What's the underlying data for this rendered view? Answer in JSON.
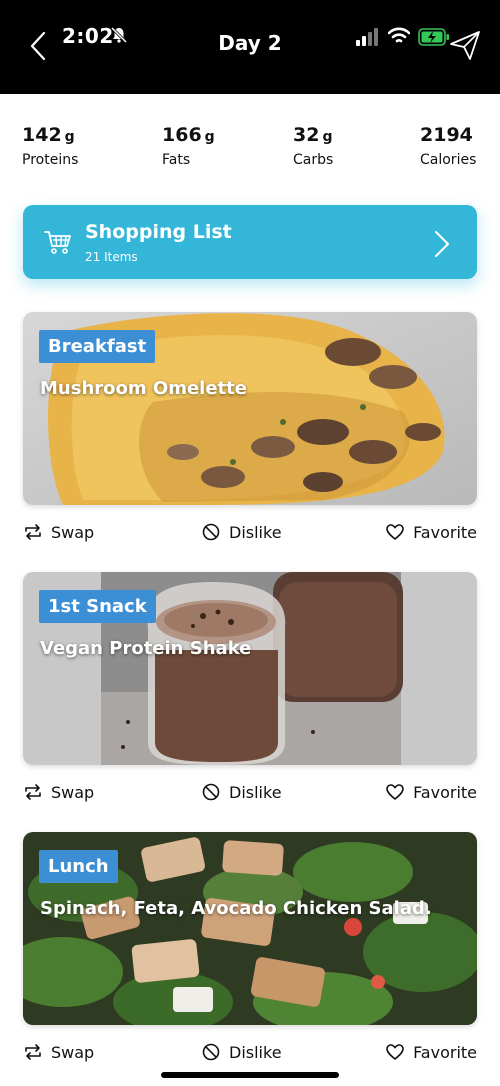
{
  "status_bar": {
    "time": "2:02"
  },
  "header": {
    "title": "Day 2",
    "back_icon": "chevron-left-icon",
    "send_icon": "paper-plane-icon"
  },
  "macros": [
    {
      "value": "142",
      "unit": "g",
      "label": "Proteins"
    },
    {
      "value": "166",
      "unit": "g",
      "label": "Fats"
    },
    {
      "value": "32",
      "unit": "g",
      "label": "Carbs"
    },
    {
      "value": "2194",
      "unit": "",
      "label": "Calories"
    }
  ],
  "shopping_list": {
    "title": "Shopping List",
    "subtitle": "21 Items",
    "color": "#34b6d8"
  },
  "meals": [
    {
      "tag": "Breakfast",
      "name": "Mushroom Omelette"
    },
    {
      "tag": "1st Snack",
      "name": "Vegan Protein Shake"
    },
    {
      "tag": "Lunch",
      "name": "Spinach, Feta, Avocado Chicken Salad."
    }
  ],
  "actions": {
    "swap": "Swap",
    "dislike": "Dislike",
    "favorite": "Favorite"
  },
  "colors": {
    "tag_bg": "#3c8fd4",
    "header_bg": "#000000"
  }
}
